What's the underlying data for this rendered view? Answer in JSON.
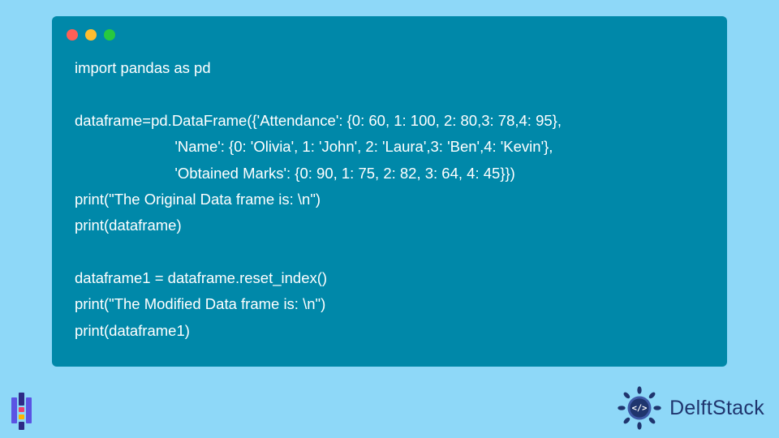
{
  "code_lines": [
    "import pandas as pd",
    "",
    "dataframe=pd.DataFrame({'Attendance': {0: 60, 1: 100, 2: 80,3: 78,4: 95},",
    "                        'Name': {0: 'Olivia', 1: 'John', 2: 'Laura',3: 'Ben',4: 'Kevin'},",
    "                        'Obtained Marks': {0: 90, 1: 75, 2: 82, 3: 64, 4: 45}})",
    "print(\"The Original Data frame is: \\n\")",
    "print(dataframe)",
    "",
    "dataframe1 = dataframe.reset_index()",
    "print(\"The Modified Data frame is: \\n\")",
    "print(dataframe1)"
  ],
  "brand": {
    "name": "DelftStack"
  },
  "colors": {
    "page_bg": "#8ed8f8",
    "window_bg": "#0088a9",
    "code_text": "#ffffff",
    "brand_text": "#1f356e",
    "dot_red": "#ff5f56",
    "dot_yellow": "#ffbd2e",
    "dot_green": "#27c93f"
  }
}
